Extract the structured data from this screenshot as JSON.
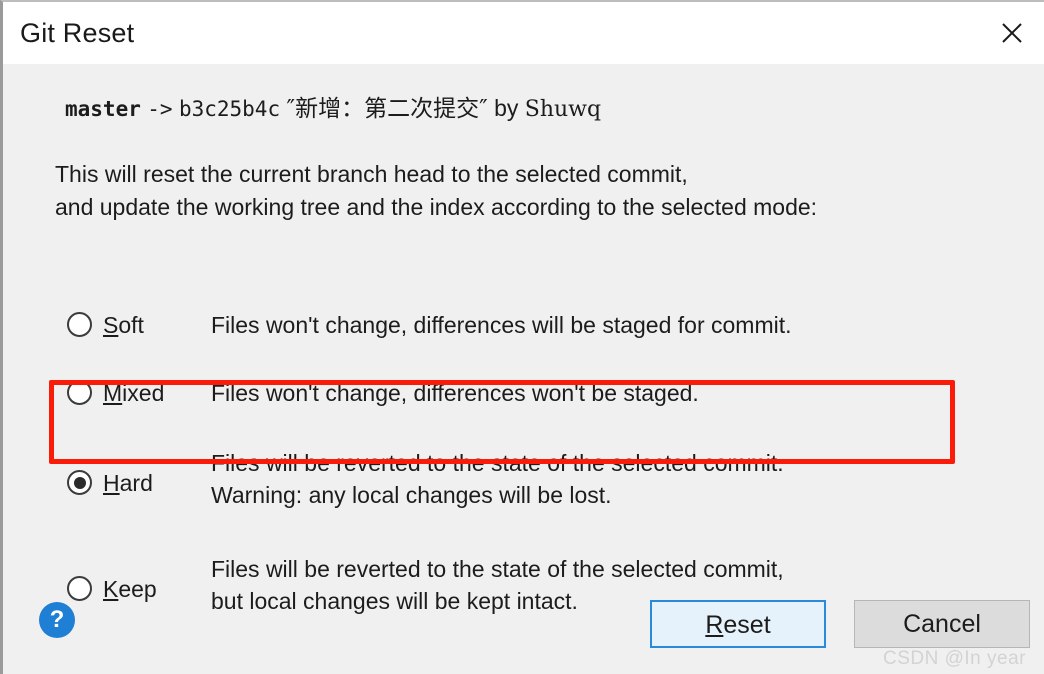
{
  "window": {
    "title": "Git Reset",
    "close_icon": "close-icon"
  },
  "commit": {
    "branch": "master",
    "arrow": "->",
    "hash": "b3c25b4c",
    "quote_open": "″",
    "message": "新增：第二次提交",
    "quote_close": "″",
    "by_label": "by",
    "author": "Shuwq"
  },
  "description": {
    "line1": "This will reset the current branch head to the selected commit,",
    "line2": "and update the working tree and the index according to the selected mode:"
  },
  "options": [
    {
      "id": "soft",
      "mnemonic": "S",
      "rest": "oft",
      "selected": false,
      "desc_line1": "Files won't change, differences will be staged for commit.",
      "desc_line2": ""
    },
    {
      "id": "mixed",
      "mnemonic": "M",
      "rest": "ixed",
      "selected": false,
      "desc_line1": "Files won't change, differences won't be staged.",
      "desc_line2": ""
    },
    {
      "id": "hard",
      "mnemonic": "H",
      "rest": "ard",
      "selected": true,
      "desc_line1": "Files will be reverted to the state of the selected commit.",
      "desc_line2": "Warning: any local changes will be lost."
    },
    {
      "id": "keep",
      "mnemonic": "K",
      "rest": "eep",
      "selected": false,
      "desc_line1": "Files will be reverted to the state of the selected commit,",
      "desc_line2": "but local changes will be kept intact."
    }
  ],
  "annotation": {
    "color": "#fb1b09",
    "target_option": "hard"
  },
  "footer": {
    "help_label": "?",
    "reset": {
      "mnemonic": "R",
      "rest": "eset"
    },
    "cancel_label": "Cancel"
  },
  "watermark": "CSDN @In year"
}
